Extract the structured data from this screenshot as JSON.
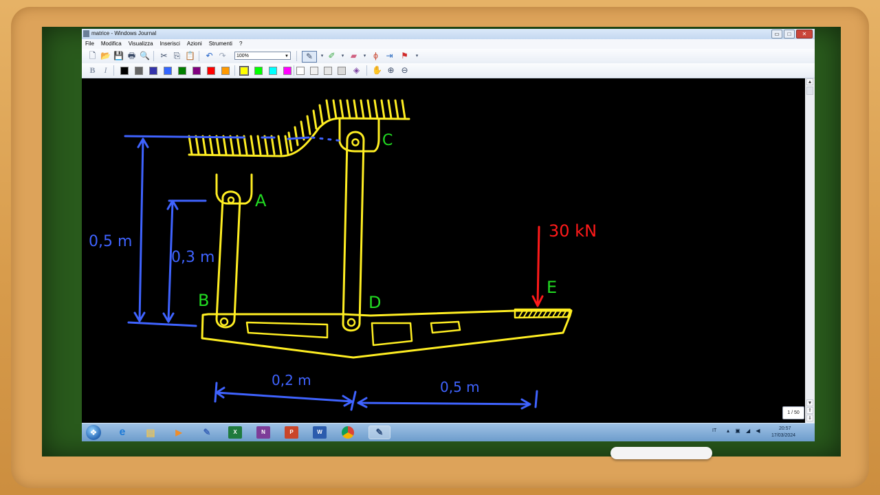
{
  "window": {
    "title": "matrice - Windows Journal",
    "controls": {
      "minimize": "▭",
      "maximize": "□",
      "close": "✕"
    }
  },
  "menu": [
    "File",
    "Modifica",
    "Visualizza",
    "Inserisci",
    "Azioni",
    "Strumenti",
    "?"
  ],
  "toolbar": {
    "zoom": "100%",
    "bold": "B",
    "italic": "I",
    "pen_colors": [
      "#000000",
      "#666666",
      "#3333aa",
      "#3366ff",
      "#007f00",
      "#800080",
      "#ff0000",
      "#ff9900"
    ],
    "highlighter_colors": [
      "#ffff00",
      "#00ff00",
      "#00ffff",
      "#ff00ff"
    ],
    "selected_highlighter": "#ffff00",
    "blank_swatches": [
      "#ffffff",
      "#f0f0f0",
      "#e6e6e6",
      "#d9d9d9"
    ]
  },
  "drawing": {
    "labels": {
      "A": "A",
      "B": "B",
      "C": "C",
      "D": "D",
      "E": "E",
      "load": "30 kN",
      "dim_total_height": "0,5 m",
      "dim_ab_height": "0,3 m",
      "dim_bd_length": "0,2 m",
      "dim_de_length": "0,5 m"
    },
    "colors": {
      "structure": "#ffee22",
      "dimension": "#3f63ff",
      "label": "#22dd22",
      "load": "#ff1a1a",
      "support_hatch": "#ffee22"
    }
  },
  "page_indicator": "1 / 50",
  "taskbar": {
    "apps": [
      "windows-start",
      "internet-explorer",
      "file-explorer",
      "media-player",
      "paint",
      "excel",
      "onenote",
      "powerpoint",
      "word",
      "chrome",
      "windows-journal"
    ],
    "tray": {
      "language": "IT",
      "time": "20:57",
      "date": "17/03/2024"
    }
  }
}
